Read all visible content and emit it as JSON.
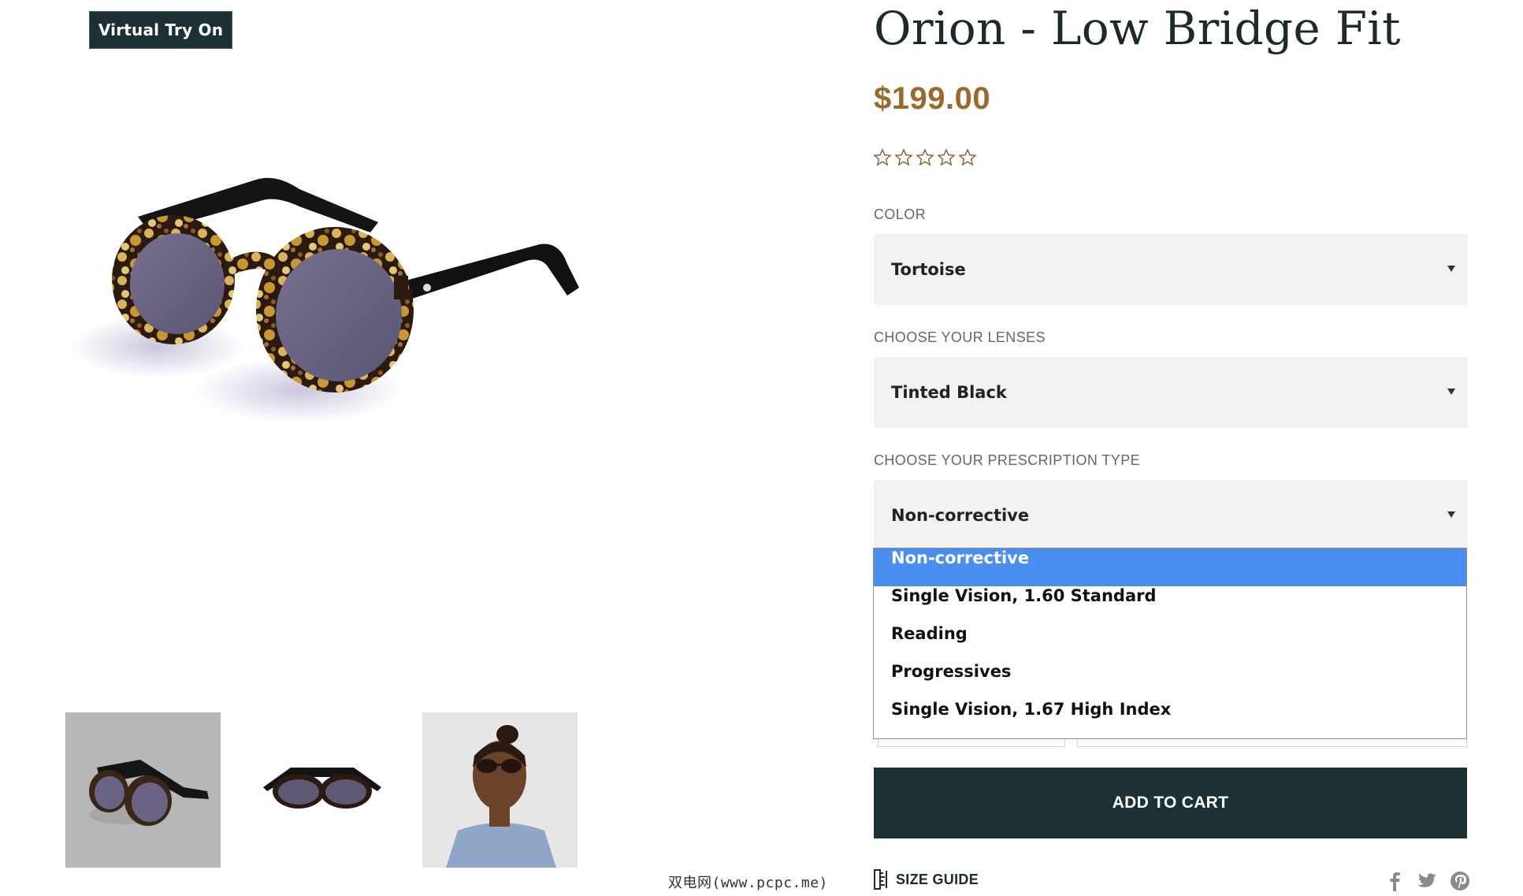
{
  "virtual_try_on_label": "Virtual Try On",
  "product": {
    "title": "Orion - Low Bridge Fit",
    "price": "$199.00",
    "rating": {
      "filled": 0,
      "max": 5
    }
  },
  "options": {
    "color": {
      "label": "COLOR",
      "value": "Tortoise"
    },
    "lenses": {
      "label": "CHOOSE YOUR LENSES",
      "value": "Tinted Black"
    },
    "prescription": {
      "label": "CHOOSE YOUR PRESCRIPTION TYPE",
      "value": "Non-corrective",
      "dropdown_open": true,
      "items": [
        "Non-corrective",
        "Single Vision, 1.60 Standard",
        "Reading",
        "Progressives",
        "Single Vision, 1.67 High Index"
      ],
      "highlighted_index": 0
    }
  },
  "add_to_cart_label": "ADD TO CART",
  "size_guide_label": "SIZE GUIDE",
  "watermark": "双电网(www.pcpc.me)",
  "colors": {
    "dark_teal": "#1d3134",
    "price_brown": "#9a6a2c",
    "select_bg": "#f2f2f2",
    "highlight_blue": "#4a8ef0",
    "star_outline": "#8a5a2a"
  },
  "icons": {
    "stars": "star-outline-icon",
    "size_guide": "ruler-icon",
    "social": [
      "facebook-icon",
      "twitter-icon",
      "pinterest-icon"
    ]
  }
}
